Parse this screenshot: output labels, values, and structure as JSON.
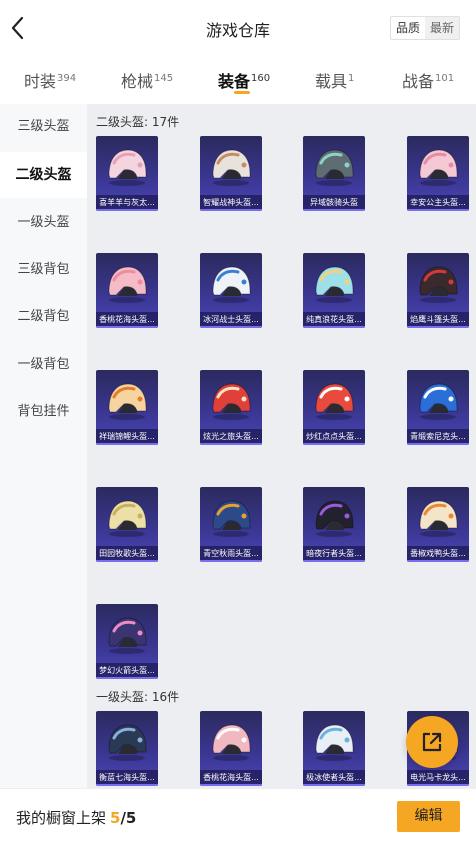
{
  "header": {
    "title": "游戏仓库",
    "sort_quality": "品质",
    "sort_latest": "最新"
  },
  "tabs": [
    {
      "label": "时装",
      "count": "394"
    },
    {
      "label": "枪械",
      "count": "145"
    },
    {
      "label": "装备",
      "count": "160"
    },
    {
      "label": "载具",
      "count": "1"
    },
    {
      "label": "战备",
      "count": "101"
    }
  ],
  "sidebar": [
    "三级头盔",
    "二级头盔",
    "一级头盔",
    "三级背包",
    "二级背包",
    "一级背包",
    "背包挂件"
  ],
  "sections": [
    {
      "title": "二级头盔: 17件"
    },
    {
      "title": "一级头盔: 16件"
    }
  ],
  "items_level2": [
    {
      "name": "喜羊羊与灰太...",
      "color": "#f3d4df",
      "accent": "#e8a0b8"
    },
    {
      "name": "智耀战神头盔...",
      "color": "#e8e2dc",
      "accent": "#c98a6a"
    },
    {
      "name": "异域骸骑头盔",
      "color": "#5e6d72",
      "accent": "#8fd0c8"
    },
    {
      "name": "幸安公主头盔...",
      "color": "#f4c9d3",
      "accent": "#e88aa5"
    },
    {
      "name": "香桃花海头盔...",
      "color": "#f5bcc8",
      "accent": "#f08aa2"
    },
    {
      "name": "冰河战士头盔...",
      "color": "#eef3f8",
      "accent": "#3a7fd0"
    },
    {
      "name": "纯真浪花头盔...",
      "color": "#9fe0e8",
      "accent": "#f3d27a"
    },
    {
      "name": "焰鹰斗篷头盔...",
      "color": "#3a2a2e",
      "accent": "#d43a3a"
    },
    {
      "name": "祥瑞锦鲤头盔...",
      "color": "#f6d4a0",
      "accent": "#e57a2c"
    },
    {
      "name": "炫光之旅头盔...",
      "color": "#e0403a",
      "accent": "#f7e3c0"
    },
    {
      "name": "炒红点点头盔...",
      "color": "#e84a3e",
      "accent": "#ffffff"
    },
    {
      "name": "青缎索尼克头...",
      "color": "#2a6fd8",
      "accent": "#ffffff"
    },
    {
      "name": "田园牧歌头盔...",
      "color": "#ece0a8",
      "accent": "#c8b060"
    },
    {
      "name": "青空秋雨头盔...",
      "color": "#2c4a8a",
      "accent": "#e8a030"
    },
    {
      "name": "暗夜行者头盔...",
      "color": "#22222e",
      "accent": "#9a5ae0"
    },
    {
      "name": "番椒戏鸭头盔...",
      "color": "#f4e4c8",
      "accent": "#e8883a"
    },
    {
      "name": "梦幻火箭头盔...",
      "color": "#3a3470",
      "accent": "#f08ac8"
    }
  ],
  "items_level1": [
    {
      "name": "衡蓝七海头盔...",
      "color": "#2a3a55",
      "accent": "#8ab0e0"
    },
    {
      "name": "香桃花海头盔...",
      "color": "#f2b8c0",
      "accent": "#ffffff"
    },
    {
      "name": "极冰使者头盔...",
      "color": "#e8f0f6",
      "accent": "#6ab0e0"
    },
    {
      "name": "电光马卡龙头...",
      "color": "#f0a0c0",
      "accent": "#ffe060"
    }
  ],
  "bottom_bar": {
    "label": "我的橱窗上架",
    "count": "5",
    "total": "/5",
    "edit": "编辑"
  }
}
